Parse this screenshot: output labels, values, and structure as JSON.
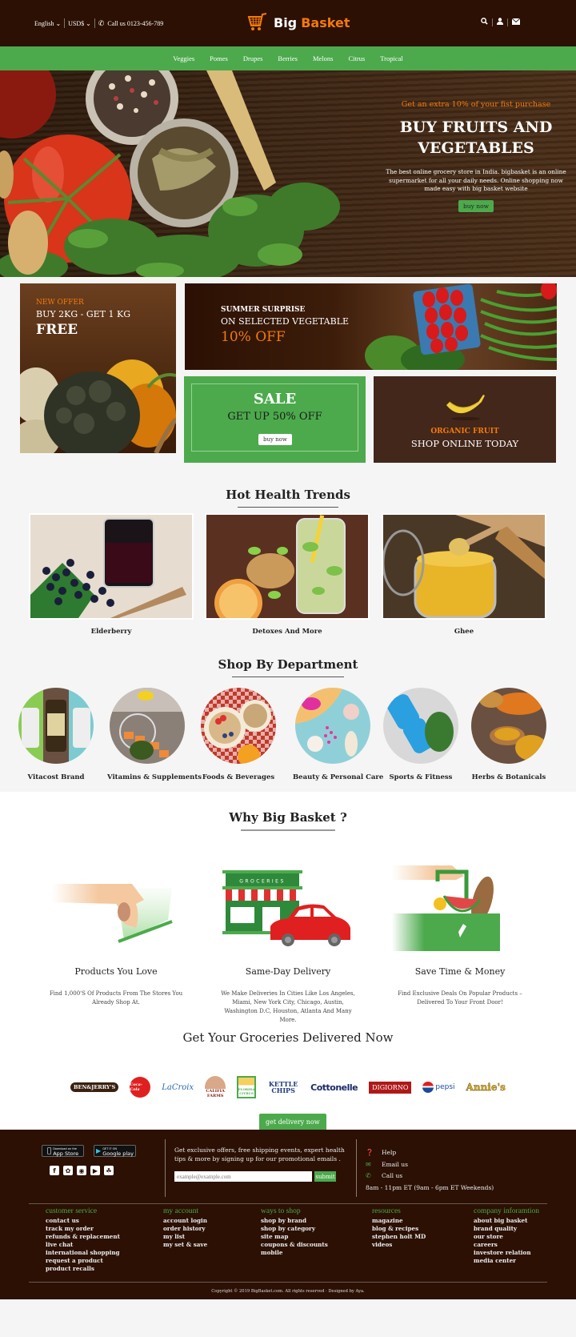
{
  "header": {
    "language": "English",
    "currency": "USD$",
    "phone_label": "Call us 0123-456-789",
    "logo_word1": "Big",
    "logo_word2": "Basket",
    "icons": [
      "search-icon",
      "user-icon",
      "envelope-icon"
    ]
  },
  "nav": {
    "items": [
      "Veggies",
      "Pomes",
      "Drupes",
      "Berries",
      "Melons",
      "Citrus",
      "Tropical"
    ]
  },
  "hero": {
    "offer": "Get an extra 10% of your fist purchase",
    "title_line1": "BUY FRUITS AND",
    "title_line2": "VEGETABLES",
    "description": "The best online grocery store in India. bigbasket is an online supermarket for all your daily needs. Online shopping now made easy with big basket website",
    "button": "buy now"
  },
  "banners": {
    "new_offer": {
      "tag": "NEW OFFER",
      "line": "BUY 2KG - GET 1 KG",
      "highlight": "FREE"
    },
    "summer": {
      "tag": "SUMMER SURPRISE",
      "line": "ON SELECTED VEGETABLE",
      "highlight": "10% OFF"
    },
    "sale": {
      "title": "SALE",
      "line": "GET UP 50% OFF",
      "button": "buy now"
    },
    "organic": {
      "tag": "ORGANIC FRUIT",
      "line": "SHOP ONLINE TODAY"
    }
  },
  "trends": {
    "title": "Hot Health Trends",
    "items": [
      {
        "label": "Elderberry"
      },
      {
        "label": "Detoxes And More"
      },
      {
        "label": "Ghee"
      }
    ]
  },
  "departments": {
    "title": "Shop By Department",
    "items": [
      {
        "label": "Vitacost Brand"
      },
      {
        "label": "Vitamins & Supplements"
      },
      {
        "label": "Foods & Beverages"
      },
      {
        "label": "Beauty & Personal Care"
      },
      {
        "label": "Sports & Fitness"
      },
      {
        "label": "Herbs & Botanicals"
      }
    ]
  },
  "why": {
    "title": "Why Big Basket ?",
    "store_sign": "GROCERIES",
    "features": [
      {
        "title": "Products You Love",
        "text": "Find 1,000'S Of Products From The Stores You Already Shop At."
      },
      {
        "title": "Same-Day Delivery",
        "text": "We Make Deliveries In Cities Like Los Angeles, Miami, New York City, Chicago, Austin, Washington D.C, Houston, Atlanta And Many More."
      },
      {
        "title": "Save Time & Money",
        "text": "Find Exclusive Deals On Popular Products – Delivered To Your Front Door!"
      }
    ]
  },
  "delivery": {
    "title": "Get Your Groceries Delivered Now",
    "brands": [
      "BEN&JERRY'S",
      "Coca-Cola",
      "LaCroix",
      "CALIFIA FARMS",
      "FLORIDA CITRUS",
      "KETTLE CHIPS",
      "Cottonelle",
      "DIGIORNO",
      "pepsi",
      "Annie's"
    ],
    "button": "get delivery now"
  },
  "footer": {
    "app_store": {
      "small": "Download on the",
      "big": "App Store"
    },
    "google_play": {
      "small": "GET IT ON",
      "big": "Google play"
    },
    "social": [
      "facebook-icon",
      "twitter-icon",
      "instagram-icon",
      "youtube-icon",
      "snapchat-icon"
    ],
    "promo_text": "Get exclusive offers, free shipping events, expert health tips & more by signing up for our promotional emails .",
    "email_placeholder": "example@example.com",
    "submit": "submit",
    "contact": {
      "help": "Help",
      "email": "Email us",
      "call": "Call us",
      "hours": "8am - 11pm ET (9am - 6pm ET Weekends)"
    },
    "columns": [
      {
        "title": "customer service",
        "links": [
          "contact us",
          "track my order",
          "refunds & replacement",
          "live chat",
          "international shopping",
          "request a product",
          "product recalls"
        ]
      },
      {
        "title": "my account",
        "links": [
          "account login",
          "order history",
          "my list",
          "my set & save"
        ]
      },
      {
        "title": "ways to shop",
        "links": [
          "shop by brand",
          "shop by category",
          "site map",
          "coupons & discounts",
          "mobile"
        ]
      },
      {
        "title": "resources",
        "links": [
          "magazine",
          "blog & recipes",
          "stephen holt MD",
          "videos"
        ]
      },
      {
        "title": "company inforamtion",
        "links": [
          "about big basket",
          "brand quality",
          "our store",
          "careers",
          "investore relation",
          "media center"
        ]
      }
    ],
    "copyright": "Copyright © 2019 BigBasket.com. All rights reserved · Designed by Aya."
  },
  "colors": {
    "brand_dark": "#2b1003",
    "brand_green": "#4caa4c",
    "brand_orange": "#f47a0a"
  }
}
